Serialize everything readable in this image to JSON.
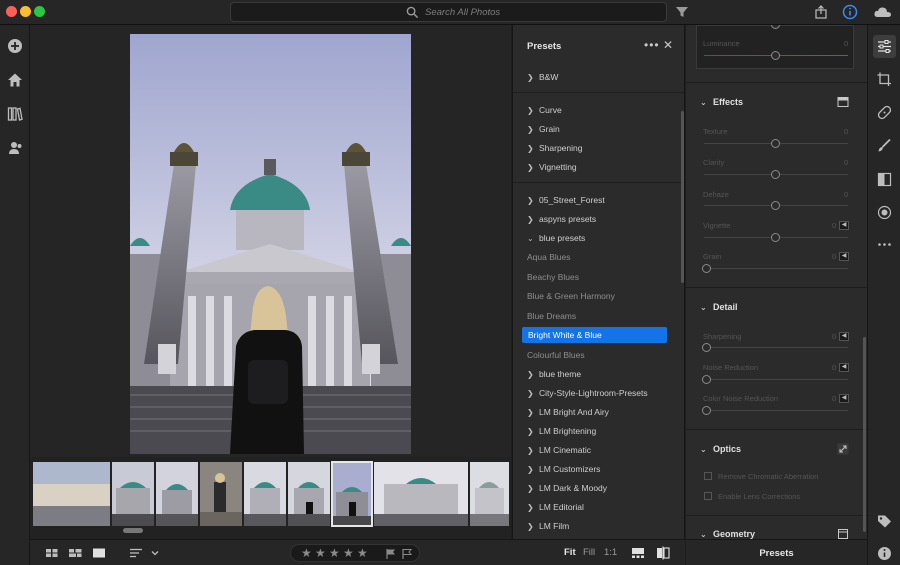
{
  "search": {
    "placeholder": "Search All Photos"
  },
  "presets_panel": {
    "title": "Presets",
    "more": "•••",
    "close": "✕",
    "groups_a": [
      {
        "label": "B&W"
      }
    ],
    "groups_b": [
      {
        "label": "Curve"
      },
      {
        "label": "Grain"
      },
      {
        "label": "Sharpening"
      },
      {
        "label": "Vignetting"
      }
    ],
    "groups_c": [
      {
        "label": "05_Street_Forest"
      },
      {
        "label": "aspyns presets"
      }
    ],
    "open_group": {
      "label": "blue presets"
    },
    "open_items": [
      "Aqua Blues",
      "Beachy Blues",
      "Blue & Green Harmony",
      "Blue Dreams"
    ],
    "selected_item": "Bright White & Blue",
    "open_items_after": [
      "Colourful Blues"
    ],
    "groups_d": [
      {
        "label": "blue theme"
      },
      {
        "label": "City-Style-Lightroom-Presets"
      },
      {
        "label": "LM Bright And Airy"
      },
      {
        "label": "LM Brightening"
      },
      {
        "label": "LM Cinematic"
      },
      {
        "label": "LM Customizers"
      },
      {
        "label": "LM Dark & Moody"
      },
      {
        "label": "LM Editorial"
      },
      {
        "label": "LM Film"
      }
    ]
  },
  "edit_panel": {
    "top_slider": {
      "label": "Luminance",
      "value": "0"
    },
    "effects": {
      "title": "Effects",
      "sliders": [
        {
          "label": "Texture",
          "value": "0",
          "pos": 0.5
        },
        {
          "label": "Clarity",
          "value": "0",
          "pos": 0.5
        },
        {
          "label": "Dehaze",
          "value": "0",
          "pos": 0.5
        },
        {
          "label": "Vignette",
          "value": "0",
          "pos": 0.5
        },
        {
          "label": "Grain",
          "value": "0",
          "pos": 0.0
        }
      ]
    },
    "detail": {
      "title": "Detail",
      "sliders": [
        {
          "label": "Sharpening",
          "value": "0",
          "pos": 0.0
        },
        {
          "label": "Noise Reduction",
          "value": "0",
          "pos": 0.0
        },
        {
          "label": "Color Noise Reduction",
          "value": "0",
          "pos": 0.0
        }
      ]
    },
    "optics": {
      "title": "Optics",
      "checks": [
        "Remove Chromatic Aberration",
        "Enable Lens Corrections"
      ]
    },
    "geometry": {
      "title": "Geometry"
    },
    "footer": "Presets"
  },
  "bottom_bar": {
    "stars": [
      "★",
      "★",
      "★",
      "★",
      "★"
    ],
    "zoom": {
      "fit": "Fit",
      "fill": "Fill",
      "one": "1:1"
    }
  },
  "colors": {
    "accent": "#1473e6",
    "panel": "#2b2b2b",
    "background": "#1e1e1e"
  }
}
